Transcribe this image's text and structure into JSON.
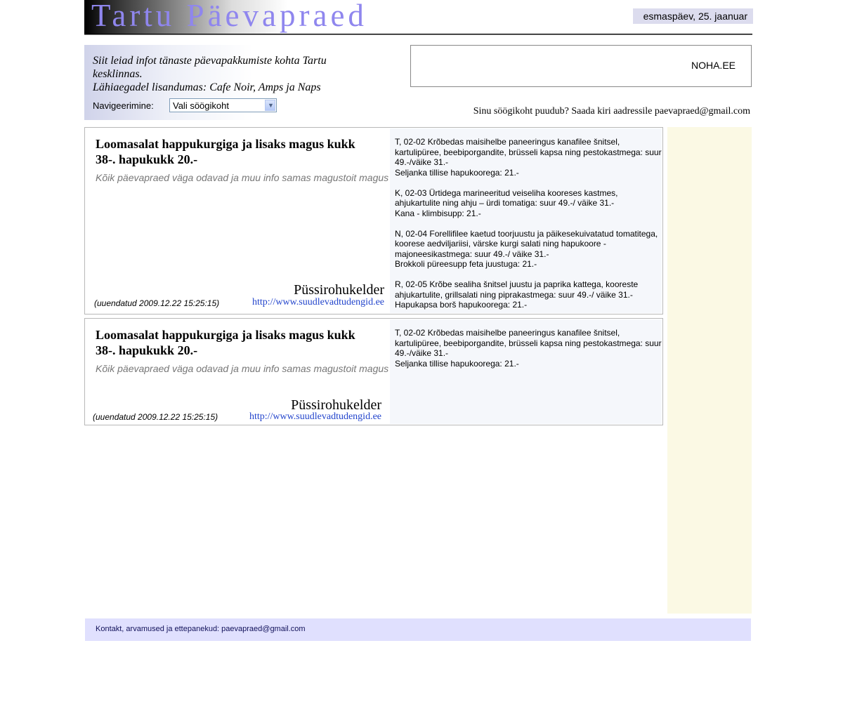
{
  "header": {
    "logo_text": "Tartu Päevapraed",
    "date": "esmaspäev, 25. jaanuar"
  },
  "intro": {
    "line1": "Siit leiad infot tänaste päevapakkumiste kohta Tartu kesklinnas.",
    "line2": "Lähiaegadel lisandumas: Cafe Noir, Amps ja Naps",
    "nav_label": "Navigeerimine:",
    "nav_select_value": "Vali söögikoht"
  },
  "ad": {
    "text": "NOHA.EE"
  },
  "missing_notice": "Sinu söögikoht puudub? Saada kiri aadressile paevapraed@gmail.com",
  "cards": [
    {
      "title": "Loomasalat happukurgiga ja lisaks magus kukk 38-. hapukukk 20.-",
      "subtitle": "Kõik päevapraed väga odavad ja muu info samas magustoit magus",
      "restaurant": "Püssirohukelder",
      "url": "http://www.suudlevadtudengid.ee",
      "updated": "(uuendatud 2009.12.22 15:25:15)",
      "menu": [
        {
          "main": "T, 02-02 Krõbedas maisihelbe paneeringus kanafilee šnitsel, kartulipüree, beebiporgandite, brüsseli kapsa ning pestokastmega: suur 49.-/väike 31.-",
          "soup": "Seljanka tillise hapukoorega: 21.-"
        },
        {
          "main": "K, 02-03 Ürtidega marineeritud veiseliha kooreses kastmes, ahjukartulite ning ahju – ürdi tomatiga: suur 49.-/ väike 31.-",
          "soup": "Kana - klimbisupp: 21.-"
        },
        {
          "main": "N, 02-04 Forellifilee kaetud toorjuustu ja päikesekuivatatud tomatitega, koorese aedviljariisi, värske kurgi salati ning hapukoore - majoneesikastmega: suur 49.-/ väike 31.-",
          "soup": "Brokkoli püreesupp feta juustuga: 21.-"
        },
        {
          "main": "R, 02-05 Krõbe sealiha šnitsel juustu ja paprika kattega, kooreste ahjukartulite, grillsalati ning piprakastmega: suur 49.-/ väike 31.-",
          "soup": "Hapukapsa borš hapukoorega: 21.-"
        }
      ]
    },
    {
      "title": "Loomasalat happukurgiga ja lisaks magus kukk 38-. hapukukk 20.-",
      "subtitle": "Kõik päevapraed väga odavad ja muu info samas magustoit magus",
      "restaurant": "Püssirohukelder",
      "url": "http://www.suudlevadtudengid.ee",
      "updated": "(uuendatud 2009.12.22 15:25:15)",
      "menu": [
        {
          "main": "T, 02-02 Krõbedas maisihelbe paneeringus kanafilee šnitsel, kartulipüree, beebiporgandite, brüsseli kapsa ning pestokastmega: suur 49.-/väike 31.-",
          "soup": "Seljanka tillise hapukoorega: 21.-"
        }
      ]
    }
  ],
  "footer": {
    "text": "Kontakt, arvamused ja ettepanekud: paevapraed@gmail.com"
  },
  "colors": {
    "logo_text": "#8f86ee",
    "date_badge": "#dcdcee",
    "sidebar": "#fbf9e4",
    "footer": "#e0e0fe",
    "link": "#2244cc"
  }
}
